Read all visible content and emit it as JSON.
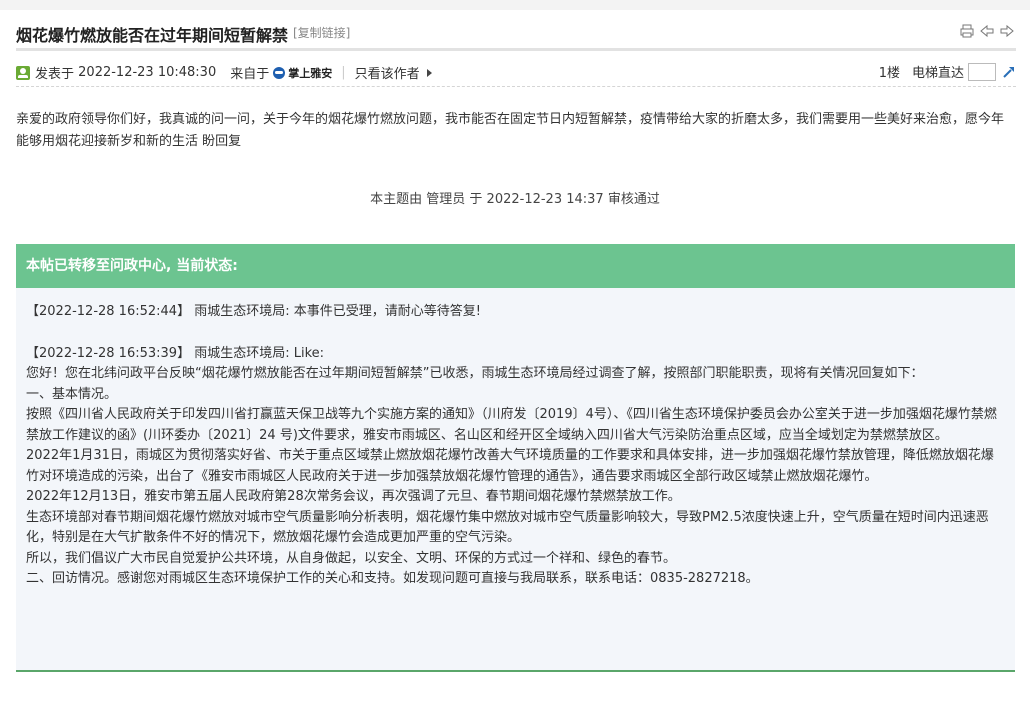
{
  "thread": {
    "title": "烟花爆竹燃放能否在过年期间短暂解禁",
    "copy_link": "[复制链接]"
  },
  "meta": {
    "posted_label": "发表于",
    "posted_time": "2022-12-23 10:48:30",
    "from_label": "来自于",
    "from_app": "掌上雅安",
    "only_author": "只看该作者",
    "floor": "1楼",
    "jump_label": "电梯直达"
  },
  "post": {
    "body": "亲爱的政府领导你们好，我真诚的问一问，关于今年的烟花爆竹燃放问题，我市能否在固定节日内短暂解禁，疫情带给大家的折磨太多，我们需要用一些美好来治愈，愿今年能够用烟花迎接新岁和新的生活 盼回复",
    "audit": "本主题由 管理员 于 2022-12-23 14:37 审核通过"
  },
  "wenzheng": {
    "header": "本帖已转移至问政中心, 当前状态:",
    "reply1": "【2022-12-28 16:52:44】 雨城生态环境局:  本事件已受理，请耐心等待答复!",
    "reply2": "【2022-12-28 16:53:39】 雨城生态环境局:  Like:",
    "paragraphs": [
      "您好！您在北纬问政平台反映“烟花爆竹燃放能否在过年期间短暂解禁”已收悉，雨城生态环境局经过调查了解，按照部门职能职责，现将有关情况回复如下：",
      "一、基本情况。",
      "按照《四川省人民政府关于印发四川省打赢蓝天保卫战等九个实施方案的通知》（川府发〔2019〕4号）、《四川省生态环境保护委员会办公室关于进一步加强烟花爆竹禁燃禁放工作建议的函》(川环委办〔2021〕24 号)文件要求，雅安市雨城区、名山区和经开区全域纳入四川省大气污染防治重点区域，应当全域划定为禁燃禁放区。",
      "2022年1月31日，雨城区为贯彻落实好省、市关于重点区域禁止燃放烟花爆竹改善大气环境质量的工作要求和具体安排，进一步加强烟花爆竹禁放管理，降低燃放烟花爆竹对环境造成的污染，出台了《雅安市雨城区人民政府关于进一步加强禁放烟花爆竹管理的通告》，通告要求雨城区全部行政区域禁止燃放烟花爆竹。",
      "2022年12月13日，雅安市第五届人民政府第28次常务会议，再次强调了元旦、春节期间烟花爆竹禁燃禁放工作。",
      "生态环境部对春节期间烟花爆竹燃放对城市空气质量影响分析表明，烟花爆竹集中燃放对城市空气质量影响较大，导致PM2.5浓度快速上升，空气质量在短时间内迅速恶化，特别是在大气扩散条件不好的情况下，燃放烟花爆竹会造成更加严重的空气污染。",
      "所以，我们倡议广大市民自觉爱护公共环境，从自身做起，以安全、文明、环保的方式过一个祥和、绿色的春节。",
      "二、回访情况。感谢您对雨城区生态环境保护工作的关心和支持。如发现问题可直接与我局联系，联系电话：0835-2827218。"
    ]
  }
}
